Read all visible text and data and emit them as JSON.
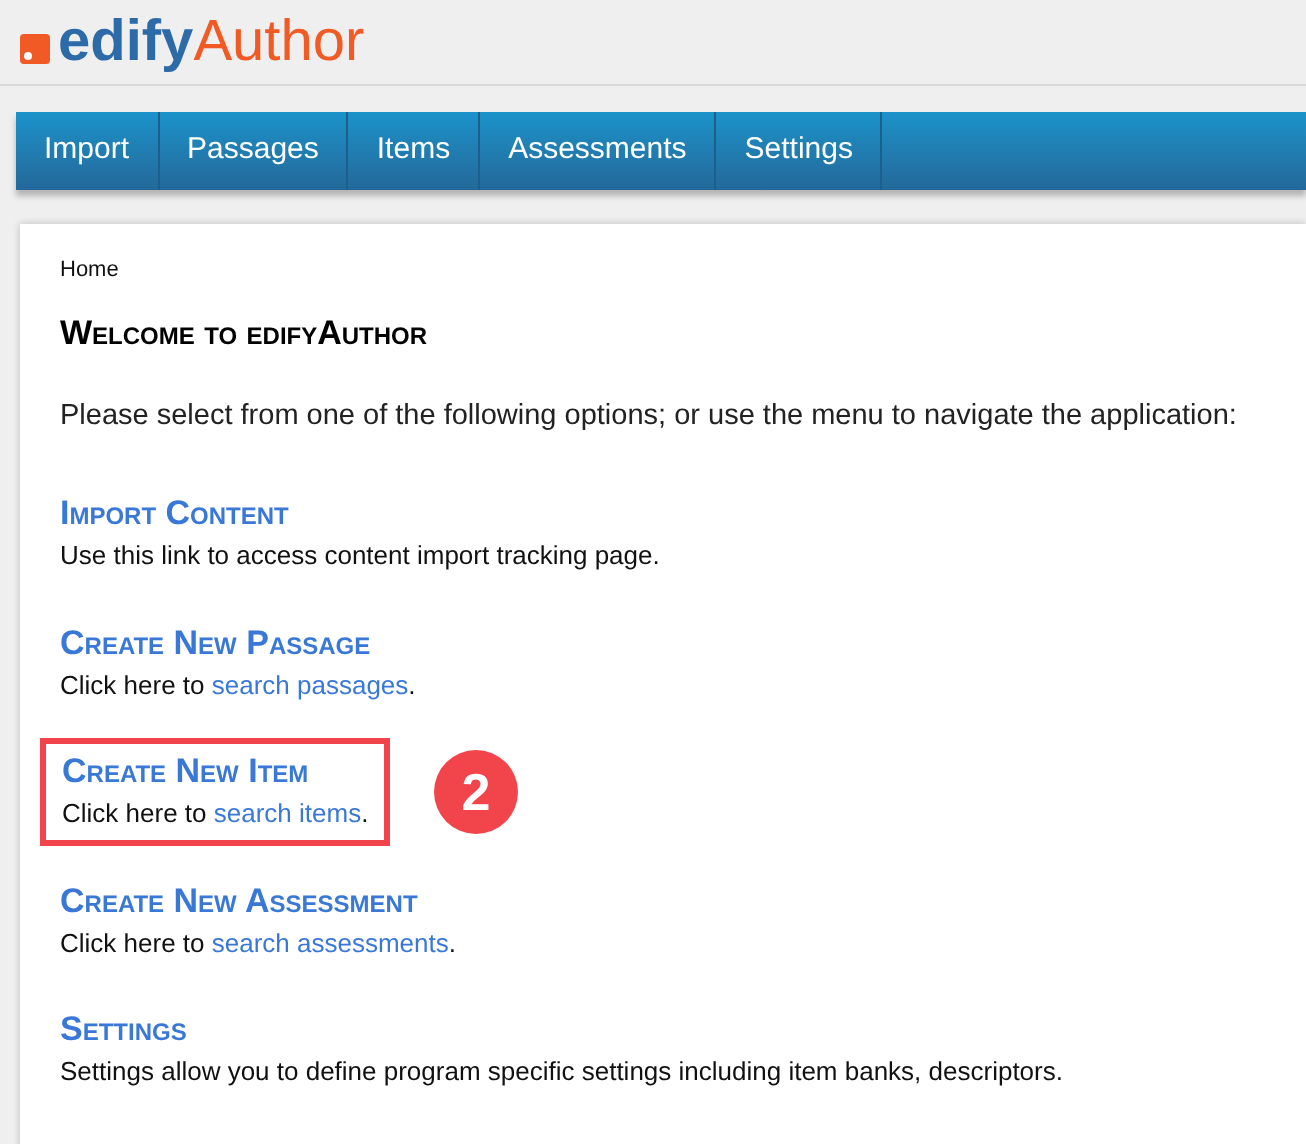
{
  "logo": {
    "first": "edify",
    "second": "Author"
  },
  "nav": [
    {
      "label": "Import"
    },
    {
      "label": "Passages"
    },
    {
      "label": "Items"
    },
    {
      "label": "Assessments"
    },
    {
      "label": "Settings"
    }
  ],
  "breadcrumb": "Home",
  "heading": "Welcome to edifyAuthor",
  "intro": "Please select from one of the following options; or use the menu to navigate the application:",
  "options": [
    {
      "title": "Import Content",
      "before": "Use this link to access content import tracking page.",
      "highlighted": false
    },
    {
      "title": "Create New Passage",
      "before": "Click here to ",
      "link": "search passages",
      "after": ".",
      "highlighted": false
    },
    {
      "title": "Create New Item",
      "before": "Click here to ",
      "link": "search items",
      "after": ".",
      "highlighted": true
    },
    {
      "title": "Create New Assessment",
      "before": "Click here to ",
      "link": "search assessments",
      "after": ".",
      "highlighted": false
    },
    {
      "title": "Settings",
      "before": "Settings allow you to define program specific settings including item banks, descriptors.",
      "highlighted": false
    }
  ],
  "callout": {
    "number": "2"
  }
}
